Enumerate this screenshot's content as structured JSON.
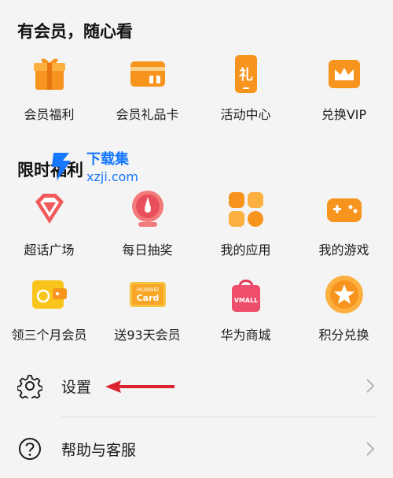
{
  "member_section": {
    "title": "有会员，随心看",
    "items": [
      {
        "label": "会员福利",
        "icon": "gift-icon"
      },
      {
        "label": "会员礼品卡",
        "icon": "gift-card-icon"
      },
      {
        "label": "活动中心",
        "icon": "phone-gift-icon"
      },
      {
        "label": "兑换VIP",
        "icon": "crown-icon"
      }
    ]
  },
  "limited_section": {
    "title": "限时福利",
    "items": [
      {
        "label": "超话广场",
        "icon": "diamond-icon"
      },
      {
        "label": "每日抽奖",
        "icon": "lottery-icon"
      },
      {
        "label": "我的应用",
        "icon": "apps-icon"
      },
      {
        "label": "我的游戏",
        "icon": "gamepad-icon"
      },
      {
        "label": "领三个月会员",
        "icon": "wallet-icon"
      },
      {
        "label": "送93天会员",
        "icon": "huawei-card-icon"
      },
      {
        "label": "华为商城",
        "icon": "vmall-bag-icon"
      },
      {
        "label": "积分兑换",
        "icon": "star-coin-icon"
      }
    ]
  },
  "huawei_card": {
    "line1": "HUAWEI",
    "line2": "Card"
  },
  "vmall_text": "VMALL",
  "settings": {
    "label": "设置",
    "icon": "gear-icon"
  },
  "help": {
    "label": "帮助与客服",
    "icon": "question-circle-icon"
  },
  "watermark": {
    "brand": "下载集",
    "url": "xzji.com"
  },
  "colors": {
    "accent_orange": "#f7941d",
    "arrow_red": "#d9232e",
    "watermark_blue": "#1677ff"
  }
}
